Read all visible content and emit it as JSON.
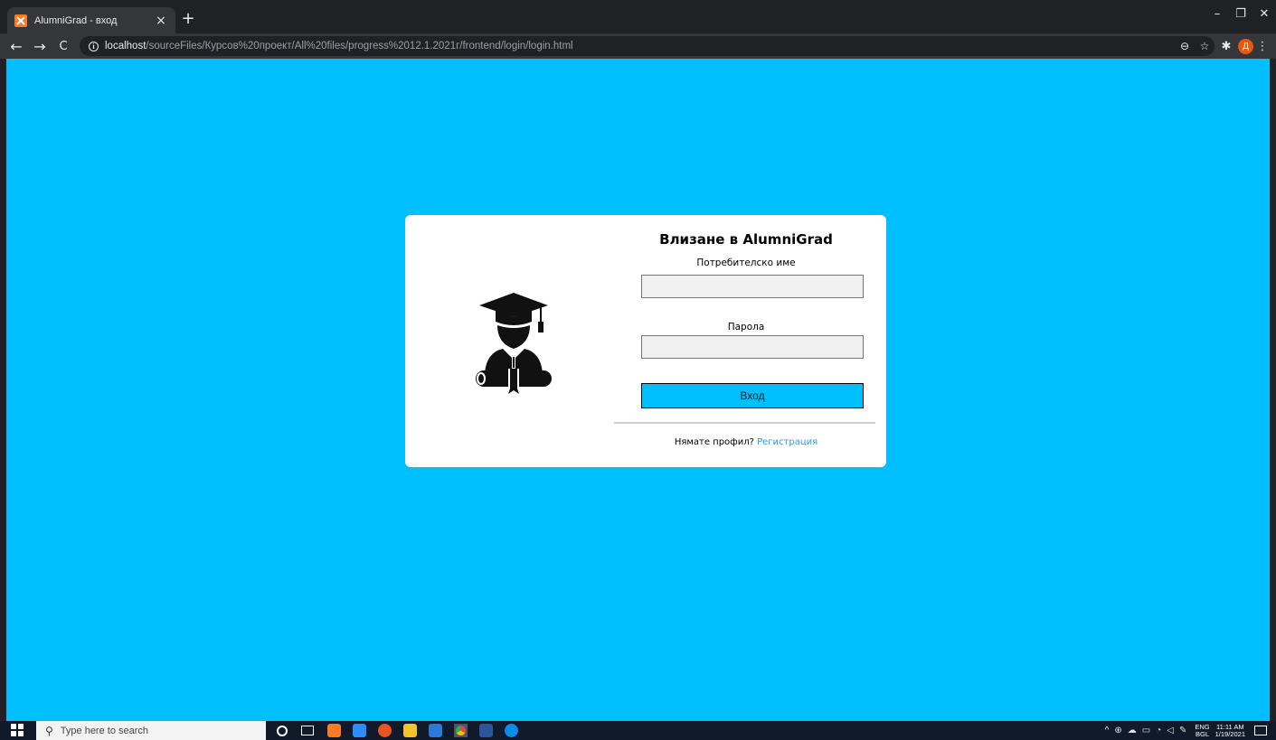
{
  "browser": {
    "tab": {
      "title": "AlumniGrad - вход",
      "close": "×"
    },
    "new_tab": "+",
    "window_controls": {
      "minimize": "–",
      "maximize": "❐",
      "close": "✕"
    },
    "nav": {
      "back": "←",
      "forward": "→",
      "reload": "C"
    },
    "address": {
      "host": "localhost",
      "path": "/sourceFiles/Курсов%20проект/All%20files/progress%2012.1.2021г/frontend/login/login.html"
    },
    "omni_icons": {
      "zoom": "⊖",
      "bookmark": "☆"
    },
    "extensions": {
      "puzzle": "✱"
    },
    "profile_initial": "Д",
    "menu": "⋮"
  },
  "login": {
    "title": "Влизане в AlumniGrad",
    "username_label": "Потребителско име",
    "username_value": "",
    "password_label": "Парола",
    "password_value": "",
    "button": "Вход",
    "no_account": "Нямате профил?",
    "register_link": "Регистрация"
  },
  "taskbar": {
    "search_placeholder": "Type here to search",
    "search_glyph": "⚲",
    "tray": {
      "chevron": "^",
      "lang_top": "ENG",
      "lang_bottom": "BGL",
      "time": "11:11 AM",
      "date": "1/19/2021"
    }
  },
  "colors": {
    "page_background": "#00bfff",
    "accent_button": "#00bfff",
    "link": "#1ea0ff",
    "browser_dark": "#202124"
  }
}
